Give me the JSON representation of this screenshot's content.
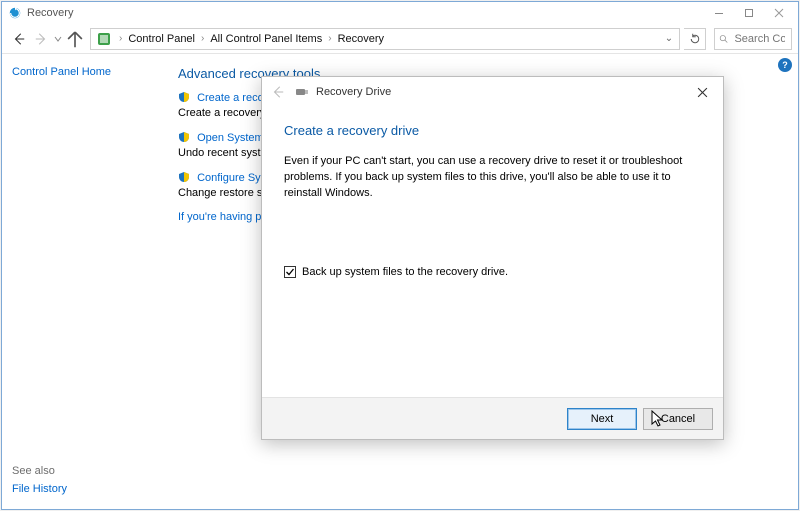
{
  "window": {
    "title": "Recovery"
  },
  "nav": {
    "crumbs": [
      "Control Panel",
      "All Control Panel Items",
      "Recovery"
    ],
    "search_placeholder": "Search Co..."
  },
  "sidebar": {
    "home": "Control Panel Home",
    "see_also_label": "See also",
    "see_also_links": [
      "File History"
    ]
  },
  "main": {
    "section_title": "Advanced recovery tools",
    "tools": [
      {
        "link": "Create a recovery drive",
        "desc": "Create a recovery drive to troubleshoot problems when your PC can't start."
      },
      {
        "link": "Open System Restore",
        "desc": "Undo recent system changes, but leave files such as documents, pictures, and music unchanged."
      },
      {
        "link": "Configure System Restore",
        "desc": "Change restore settings, manage disk space, and create or delete restore points."
      }
    ],
    "trouble_link": "If you're having problems with your PC, go to Settings and try resetting it"
  },
  "dialog": {
    "crumb": "Recovery Drive",
    "title": "Create a recovery drive",
    "desc": "Even if your PC can't start, you can use a recovery drive to reset it or troubleshoot problems. If you back up system files to this drive, you'll also be able to use it to reinstall Windows.",
    "checkbox_label": "Back up system files to the recovery drive.",
    "checkbox_checked": true,
    "next_label": "Next",
    "cancel_label": "Cancel"
  },
  "help_icon": "?"
}
